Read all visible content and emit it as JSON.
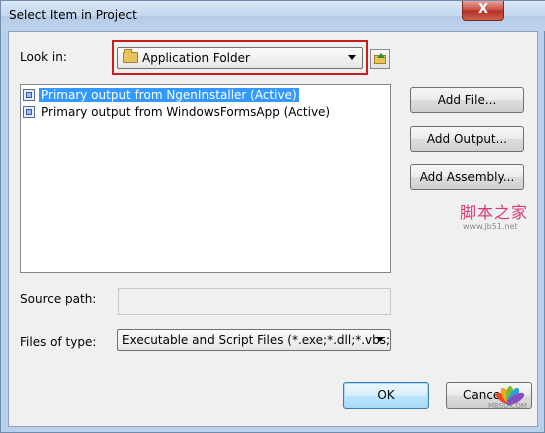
{
  "window": {
    "title": "Select Item in Project",
    "close_glyph": "X"
  },
  "look_in": {
    "label": "Look in:",
    "value": "Application Folder",
    "icon": "folder-icon"
  },
  "up_folder": {
    "icon": "folder-up-icon"
  },
  "list": {
    "items": [
      {
        "label": "Primary output from NgenInstaller (Active)",
        "selected": true
      },
      {
        "label": "Primary output from WindowsFormsApp (Active)",
        "selected": false
      }
    ]
  },
  "side_buttons": {
    "add_file": "Add File...",
    "add_output": "Add Output...",
    "add_assembly": "Add Assembly..."
  },
  "source_path": {
    "label": "Source path:",
    "value": ""
  },
  "files_of_type": {
    "label": "Files of type:",
    "value": "Executable and Script Files (*.exe;*.dll;*.vbs;"
  },
  "footer": {
    "ok": "OK",
    "cancel": "Cance"
  },
  "watermark": {
    "text": "脚本之家",
    "url": "www.jb51.net",
    "logo_text": "MBSU.COM"
  }
}
